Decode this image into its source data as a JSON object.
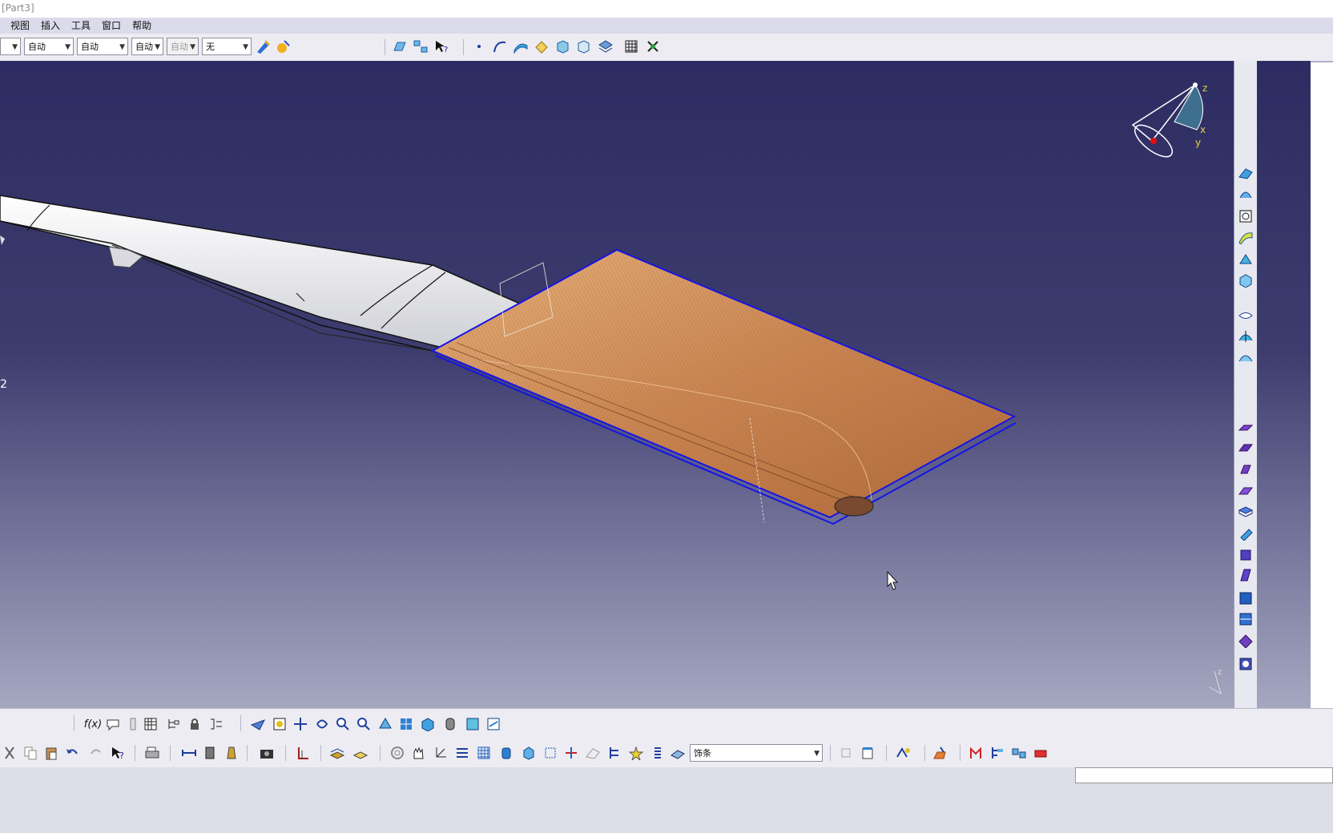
{
  "window": {
    "title": "[Part3]"
  },
  "menu": {
    "items": [
      "视图",
      "插入",
      "工具",
      "窗口",
      "帮助"
    ]
  },
  "toolbar_top": {
    "combos": [
      "自动",
      "自动",
      "自动",
      "自动",
      "无"
    ]
  },
  "viewport": {
    "left_label": "2",
    "compass": {
      "z": "z",
      "x": "x",
      "y": "y"
    },
    "mini_axis": "z"
  },
  "bottom_toolbar": {
    "formula_icon_label": "f(x)",
    "style_combo": "饰条"
  },
  "colors": {
    "viewport_top": "#2d2c62",
    "viewport_bottom": "#a6a7c0",
    "surface": "#c67c47",
    "edge_highlight": "#1414e6"
  }
}
